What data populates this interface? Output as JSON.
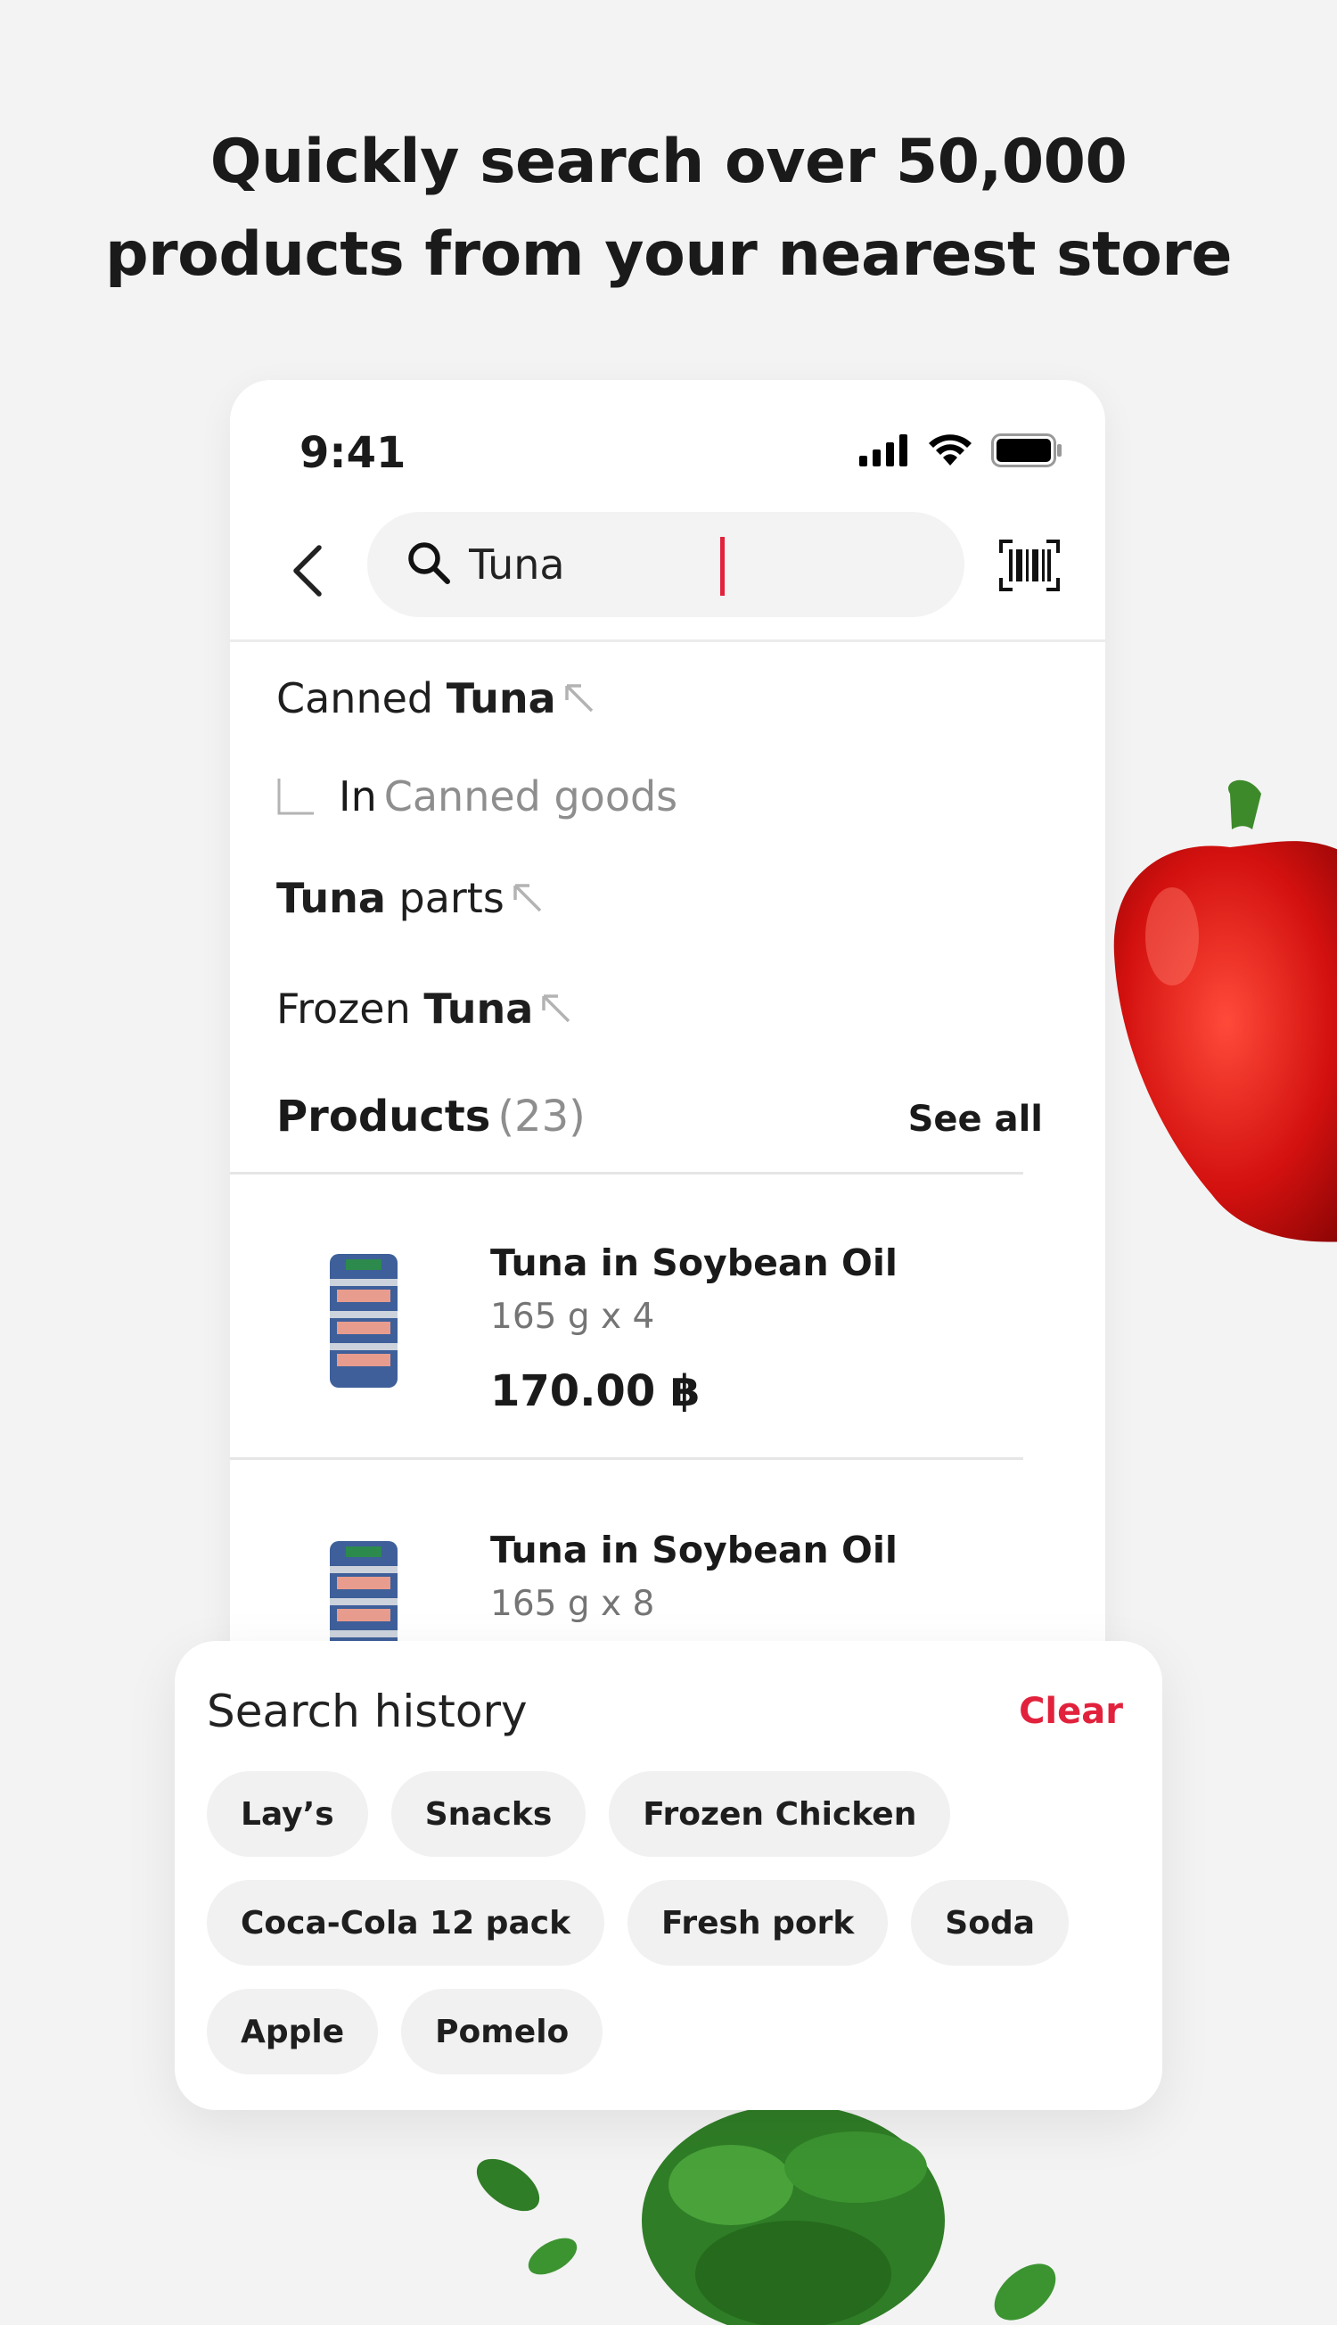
{
  "headline": {
    "line1": "Quickly search over 50,000",
    "line2": "products from your nearest store"
  },
  "status_bar": {
    "time": "9:41"
  },
  "search": {
    "value": "Tuna"
  },
  "suggestions": [
    {
      "prefix": "Canned ",
      "bold": "Tuna",
      "suffix": ""
    },
    {
      "prefix": "",
      "bold": "Tuna",
      "suffix": " parts"
    },
    {
      "prefix": "Frozen ",
      "bold": "Tuna",
      "suffix": ""
    }
  ],
  "category_suggestion": {
    "in_label": "In",
    "category": "Canned goods"
  },
  "products": {
    "title": "Products",
    "count": "(23)",
    "see_all": "See all",
    "items": [
      {
        "name": "Tuna in Soybean Oil",
        "qty": "165 g x 4",
        "price": "170.00 ฿"
      },
      {
        "name": "Tuna in Soybean Oil",
        "qty": "165 g x 8",
        "price": ""
      }
    ]
  },
  "search_history": {
    "title": "Search history",
    "clear": "Clear",
    "chips": [
      [
        "Lay’s",
        "Snacks",
        "Frozen Chicken"
      ],
      [
        "Coca-Cola 12 pack",
        "Fresh pork",
        "Soda"
      ],
      [
        "Apple",
        "Pomelo"
      ]
    ]
  },
  "icons": {
    "back": "chevron-left-icon",
    "search": "search-icon",
    "barcode": "barcode-scanner-icon",
    "suggestion_arrow": "arrow-up-left-icon",
    "signal": "cellular-signal-icon",
    "wifi": "wifi-icon",
    "battery": "battery-icon"
  },
  "colors": {
    "accent": "#e2223c",
    "background": "#f3f3f3",
    "chip": "#f1f1f1"
  }
}
